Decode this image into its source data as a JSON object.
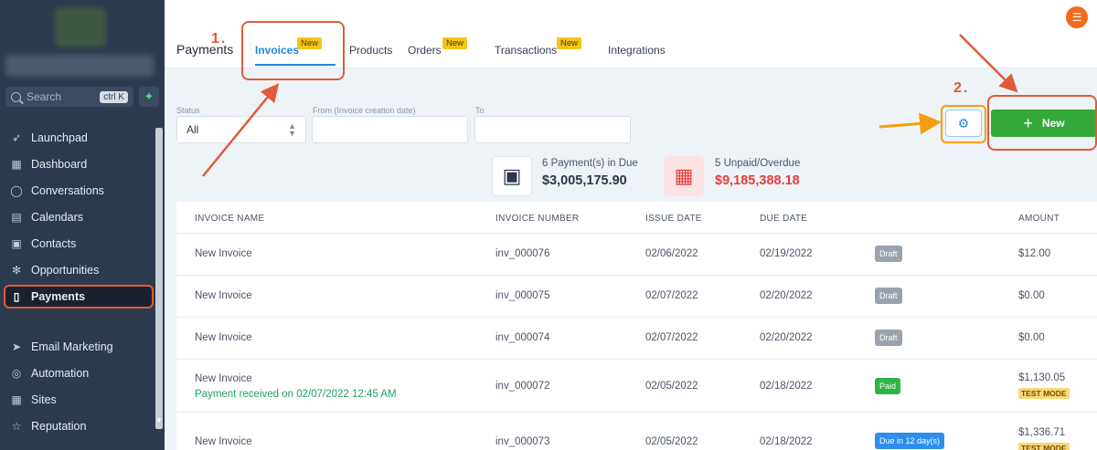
{
  "sidebar": {
    "search_placeholder": "Search",
    "search_shortcut": "ctrl K",
    "items": [
      {
        "label": "Launchpad",
        "icon": "rocket-icon"
      },
      {
        "label": "Dashboard",
        "icon": "grid-icon"
      },
      {
        "label": "Conversations",
        "icon": "chat-icon"
      },
      {
        "label": "Calendars",
        "icon": "calendar-icon"
      },
      {
        "label": "Contacts",
        "icon": "contacts-icon"
      },
      {
        "label": "Opportunities",
        "icon": "opportunities-icon"
      },
      {
        "label": "Payments",
        "icon": "payments-icon",
        "active": true
      },
      {
        "label": "Email Marketing",
        "icon": "send-icon"
      },
      {
        "label": "Automation",
        "icon": "automation-icon"
      },
      {
        "label": "Sites",
        "icon": "globe-icon"
      },
      {
        "label": "Reputation",
        "icon": "star-icon"
      }
    ]
  },
  "header": {
    "title": "Payments",
    "tabs": [
      {
        "label": "Invoices",
        "badge": "New",
        "active": true
      },
      {
        "label": "Products"
      },
      {
        "label": "Orders",
        "badge": "New"
      },
      {
        "label": "Transactions",
        "badge": "New"
      },
      {
        "label": "Integrations"
      }
    ]
  },
  "filters": {
    "status_label": "Status",
    "status_value": "All",
    "from_label": "From (Invoice creation date)",
    "to_label": "To"
  },
  "actions": {
    "new_label": "New",
    "settings_icon": "gear-icon"
  },
  "stats": {
    "due_label": "6  Payment(s) in Due",
    "due_value": "$3,005,175.90",
    "overdue_label": "5  Unpaid/Overdue",
    "overdue_value": "$9,185,388.18"
  },
  "table": {
    "columns": [
      "INVOICE NAME",
      "INVOICE NUMBER",
      "ISSUE DATE",
      "DUE DATE",
      "AMOUNT"
    ],
    "rows": [
      {
        "name": "New Invoice",
        "number": "inv_000076",
        "issue": "02/06/2022",
        "due": "02/19/2022",
        "status": "Draft",
        "amount": "$12.00"
      },
      {
        "name": "New Invoice",
        "number": "inv_000075",
        "issue": "02/07/2022",
        "due": "02/20/2022",
        "status": "Draft",
        "amount": "$0.00"
      },
      {
        "name": "New Invoice",
        "number": "inv_000074",
        "issue": "02/07/2022",
        "due": "02/20/2022",
        "status": "Draft",
        "amount": "$0.00"
      },
      {
        "name": "New Invoice",
        "note": "Payment received on 02/07/2022 12:45 AM",
        "number": "inv_000072",
        "issue": "02/05/2022",
        "due": "02/18/2022",
        "status": "Paid",
        "amount": "$1,130.05",
        "tag": "TEST MODE"
      },
      {
        "name": "New Invoice",
        "number": "inv_000073",
        "issue": "02/05/2022",
        "due": "02/18/2022",
        "status": "Due in 12 day(s)",
        "amount": "$1,336.71",
        "tag": "TEST MODE"
      }
    ]
  },
  "annotations": {
    "step1": "1.",
    "step2": "2."
  },
  "colors": {
    "sidebar_bg": "#2c3a4e",
    "accent_blue": "#1e88e5",
    "new_button": "#35a83a",
    "annotation_red": "#e05a3a",
    "annotation_orange": "#f59e0b",
    "overdue_red": "#e53e3e"
  }
}
